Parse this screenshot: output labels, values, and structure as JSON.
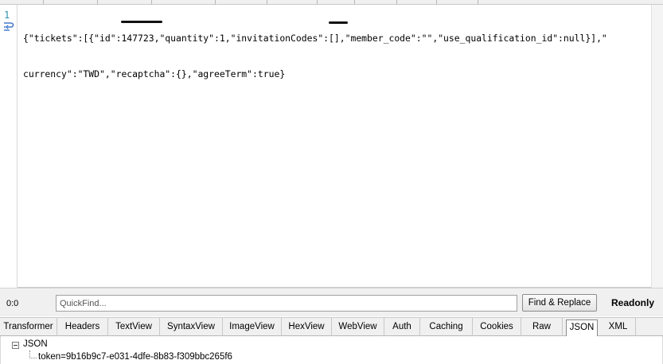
{
  "header": {
    "cut_tab_label": "SyntaxView"
  },
  "editor": {
    "line_number": "1",
    "wrap_icon": "word-wrap-icon",
    "lines": [
      "{\"tickets\":[{\"id\":147723,\"quantity\":1,\"invitationCodes\":[],\"member_code\":\"\",\"use_qualification_id\":null}],\"",
      "currency\":\"TWD\",\"recaptcha\":{},\"agreeTerm\":true}"
    ]
  },
  "statusbar": {
    "position": "0:0",
    "quickfind_placeholder": "QuickFind...",
    "find_replace_label": "Find & Replace",
    "readonly_label": "Readonly"
  },
  "tabs": [
    {
      "label": "Transformer",
      "active": false
    },
    {
      "label": "Headers",
      "active": false
    },
    {
      "label": "TextView",
      "active": false
    },
    {
      "label": "SyntaxView",
      "active": false
    },
    {
      "label": "ImageView",
      "active": false
    },
    {
      "label": "HexView",
      "active": false
    },
    {
      "label": "WebView",
      "active": false
    },
    {
      "label": "Auth",
      "active": false
    },
    {
      "label": "Caching",
      "active": false
    },
    {
      "label": "Cookies",
      "active": false
    },
    {
      "label": "Raw",
      "active": false
    },
    {
      "label": "JSON",
      "active": true
    },
    {
      "label": "XML",
      "active": false
    }
  ],
  "tree": {
    "root_label": "JSON",
    "child_label": "token=9b16b9c7-e031-4dfe-8b83-f309bbc265f6"
  }
}
